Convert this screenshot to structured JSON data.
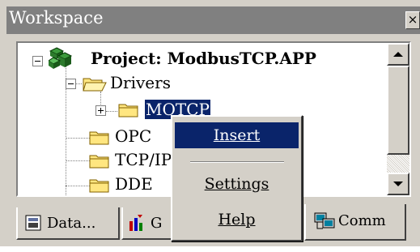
{
  "window": {
    "title": "Workspace",
    "close_glyph": "×"
  },
  "tree": {
    "project_label": "Project: ModbusTCP.APP",
    "drivers_label": "Drivers",
    "motcp_label": "MOTCP",
    "opc_label": "OPC",
    "tcpip_label": "TCP/IP",
    "dde_label": "DDE"
  },
  "tabs": [
    {
      "label": "Data...",
      "icon": "database-icon"
    },
    {
      "label": "G",
      "icon": "graphics-icon"
    },
    {
      "label": "Comm",
      "icon": "comm-icon"
    }
  ],
  "context_menu": {
    "insert_label": "Insert",
    "settings_label": "Settings",
    "help_label": "Help"
  },
  "colors": {
    "selection": "#0a246a",
    "face": "#d4d0c8",
    "title_inactive": "#808080",
    "folder": "#ffe680"
  }
}
